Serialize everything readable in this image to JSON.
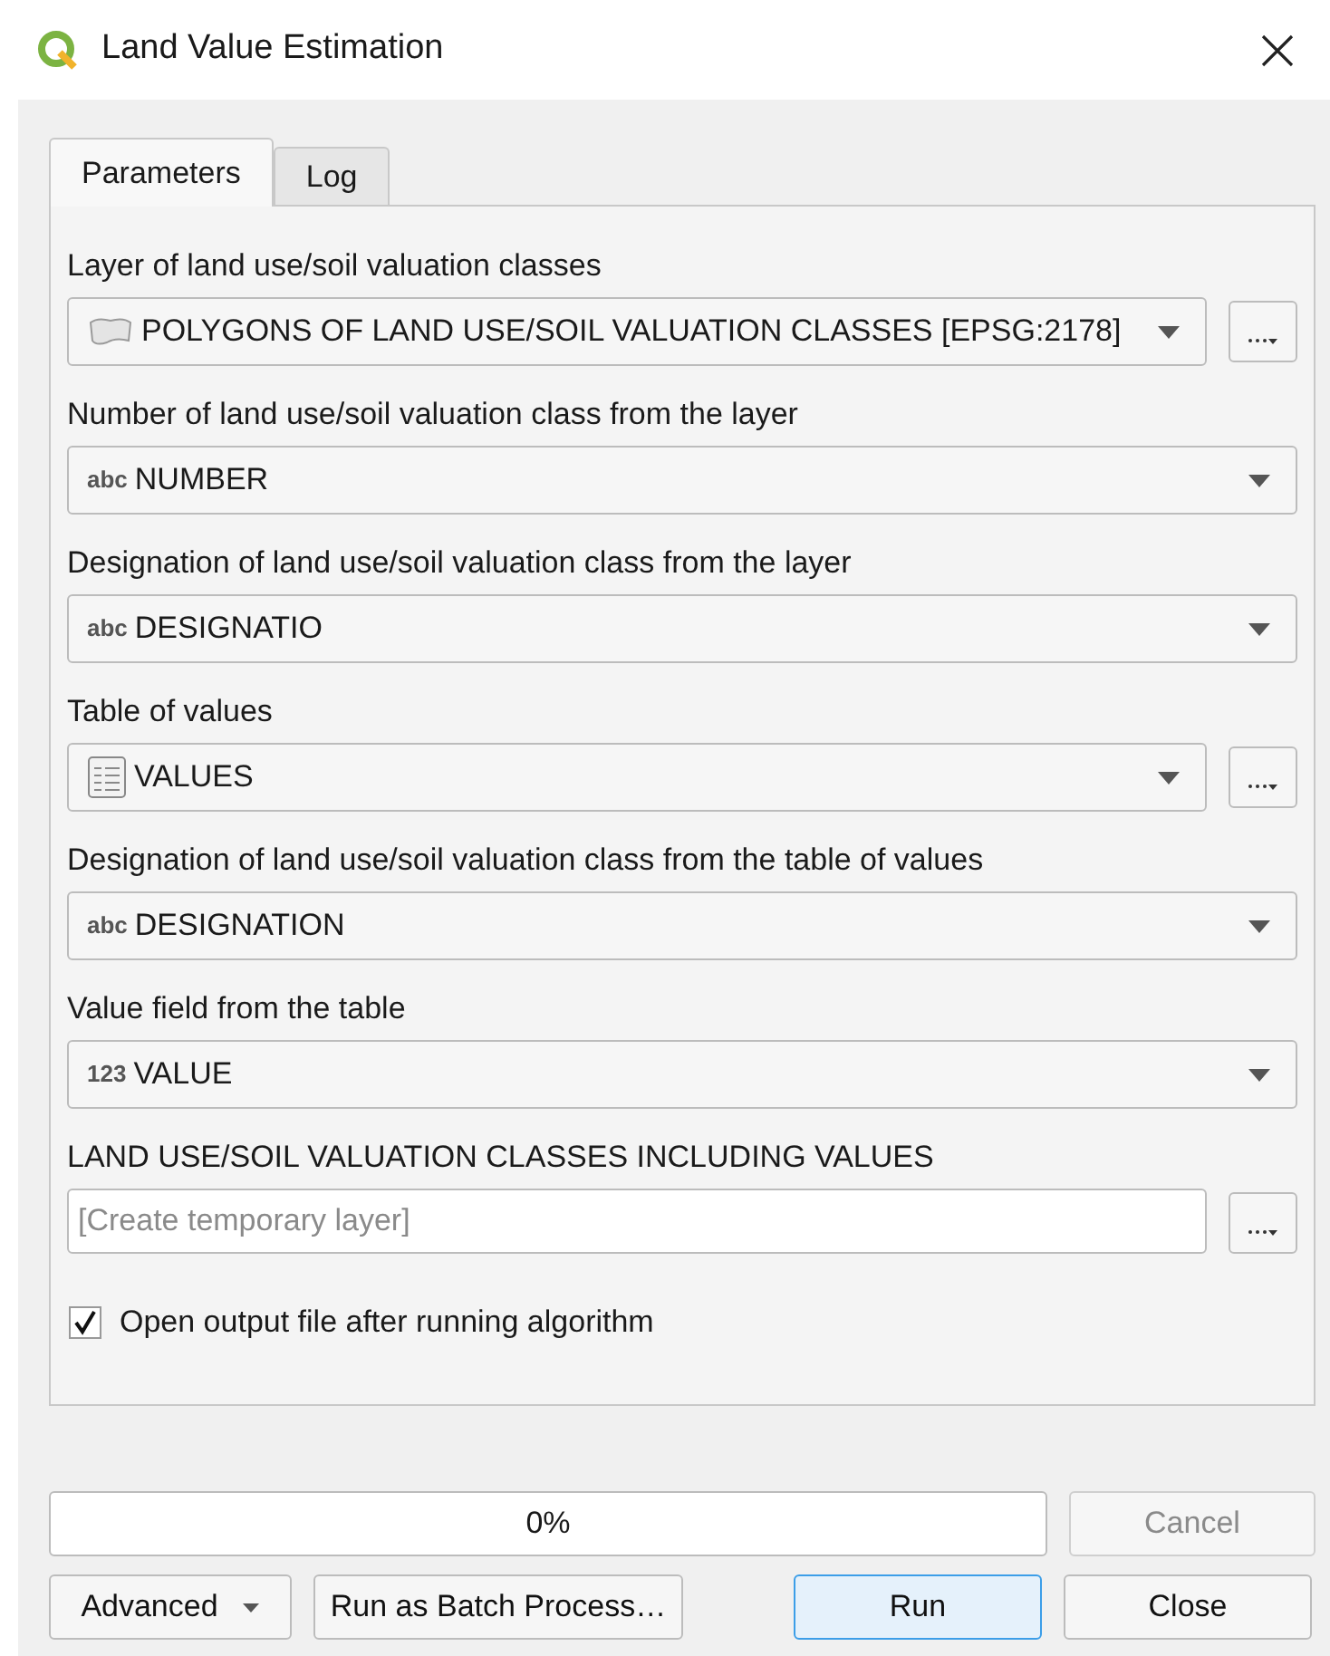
{
  "window": {
    "title": "Land Value Estimation"
  },
  "tabs": [
    {
      "label": "Parameters",
      "selected": true
    },
    {
      "label": "Log",
      "selected": false
    }
  ],
  "parameters": [
    {
      "kind": "layer",
      "label": "Layer of land use/soil valuation classes",
      "value": "POLYGONS OF LAND USE/SOIL VALUATION CLASSES [EPSG:2178]",
      "browse": true
    },
    {
      "kind": "field",
      "label": "Number of land use/soil valuation class from the layer",
      "type": "abc",
      "value": "NUMBER",
      "browse": false
    },
    {
      "kind": "field",
      "label": "Designation of land use/soil valuation class from the layer",
      "type": "abc",
      "value": "DESIGNATIO",
      "browse": false
    },
    {
      "kind": "table",
      "label": "Table of values",
      "value": "VALUES",
      "browse": true
    },
    {
      "kind": "field",
      "label": "Designation of land use/soil valuation class from the table of values",
      "type": "abc",
      "value": "DESIGNATION",
      "browse": false
    },
    {
      "kind": "field",
      "label": "Value field from the table",
      "type": "123",
      "value": "VALUE",
      "browse": false
    },
    {
      "kind": "output",
      "label": "LAND USE/SOIL VALUATION CLASSES INCLUDING VALUES",
      "placeholder": "[Create temporary layer]",
      "browse": true
    },
    {
      "kind": "checkbox",
      "label": "Open output file after running algorithm",
      "checked": true
    }
  ],
  "progress": {
    "text": "0%",
    "level": 0
  },
  "buttons": [
    {
      "label": "Cancel",
      "kind": "cancel",
      "disabled": true
    },
    {
      "label": "Advanced",
      "kind": "menu",
      "disabled": false
    },
    {
      "label": "Run as Batch Process…",
      "kind": "plain",
      "disabled": false
    },
    {
      "label": "Run",
      "kind": "default",
      "disabled": false
    },
    {
      "label": "Close",
      "kind": "plain",
      "disabled": false
    }
  ]
}
